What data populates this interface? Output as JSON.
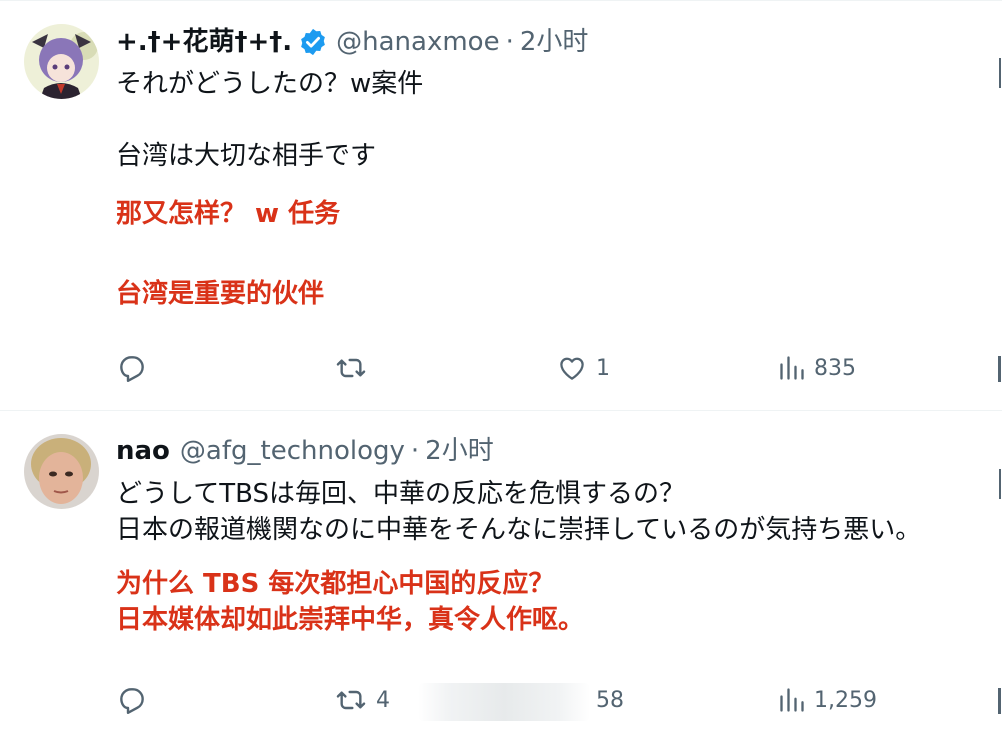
{
  "colors": {
    "text": "#0f1419",
    "secondary": "#536471",
    "translation": "#d93218",
    "verified": "#1d9bf0",
    "divider": "#eff3f4"
  },
  "tweets": [
    {
      "name": "+.†+花萌†+†.",
      "verified": true,
      "handle": "@hanaxmoe",
      "dot": "·",
      "time": "2小时",
      "text": "それがどうしたの？w案件\n\n台湾は大切な相手です",
      "translation_line1": "那又怎样？ w 任务",
      "translation_line2": "台湾是重要的伙伴",
      "actions": {
        "reply": "",
        "retweet": "",
        "like": "1",
        "views": "835"
      },
      "icons": [
        "reply-icon",
        "retweet-icon",
        "like-icon",
        "views-icon"
      ]
    },
    {
      "name": "nao",
      "verified": false,
      "handle": "@afg_technology",
      "dot": "·",
      "time": "2小时",
      "text": "どうしてTBSは毎回、中華の反応を危惧するの？\n日本の報道機関なのに中華をそんなに崇拝しているのが気持ち悪い。",
      "translation": "为什么 TBS 每次都担心中国的反应？\n日本媒体却如此崇拜中华，真令人作呕。",
      "actions": {
        "reply": "",
        "retweet": "4",
        "like": "58",
        "views": "1,259"
      },
      "icons": [
        "reply-icon",
        "retweet-icon",
        "like-icon",
        "views-icon"
      ]
    }
  ]
}
